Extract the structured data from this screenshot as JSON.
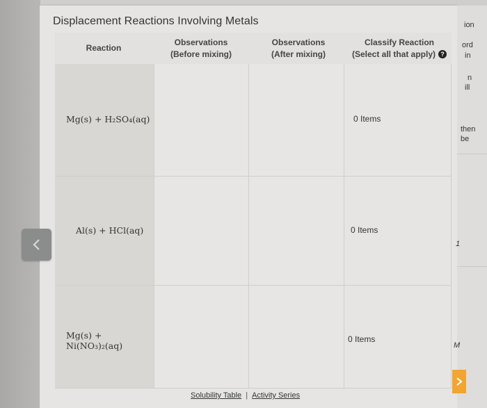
{
  "page": {
    "title": "Displacement Reactions Involving Metals"
  },
  "table": {
    "headers": {
      "reaction": "Reaction",
      "obs_before_line1": "Observations",
      "obs_before_line2": "(Before mixing)",
      "obs_after_line1": "Observations",
      "obs_after_line2": "(After mixing)",
      "classify_line1": "Classify Reaction",
      "classify_line2": "(Select all that apply)"
    },
    "rows": [
      {
        "reaction": "Mg(s) + H₂SO₄(aq)",
        "items": "0 Items"
      },
      {
        "reaction": "Al(s) + HCl(aq)",
        "items": "0 Items"
      },
      {
        "reaction": "Mg(s) + Ni(NO₃)₂(aq)",
        "items": "0 Items"
      }
    ]
  },
  "footer": {
    "solubility_table": "Solubility Table",
    "separator": "|",
    "activity_series": "Activity Series"
  },
  "right_panel": {
    "fragments": [
      "ion",
      "ord",
      "in",
      "n",
      "ill",
      "then",
      "be",
      "1",
      "M"
    ]
  },
  "icons": {
    "info": "info-icon",
    "prev": "chevron-left-icon",
    "next": "chevron-right-icon"
  },
  "colors": {
    "accent_orange": "#f2a531",
    "info_icon": "#222222"
  }
}
